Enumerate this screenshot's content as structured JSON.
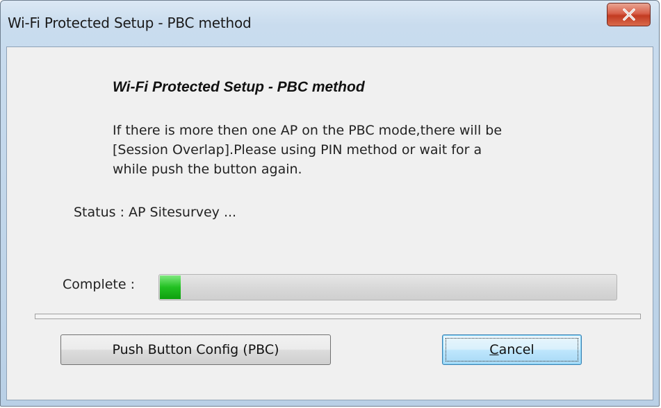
{
  "window": {
    "title": "Wi-Fi Protected Setup - PBC method",
    "close_icon": "close-x-icon"
  },
  "dialog": {
    "heading": "Wi-Fi Protected Setup - PBC method",
    "description_lines": [
      "If there is more then one AP on the PBC mode,there will be",
      "[Session Overlap].Please using PIN method or wait for a",
      "while push the button again."
    ],
    "status_text": "Status : AP Sitesurvey ...",
    "complete_label": "Complete :",
    "progress_fraction": 0.045
  },
  "buttons": {
    "pbc_label": "Push Button Config (PBC)",
    "cancel_mnemonic": "C",
    "cancel_rest": "ancel"
  },
  "colors": {
    "progress_fill": "#22c022",
    "close_button": "#c23b22"
  }
}
